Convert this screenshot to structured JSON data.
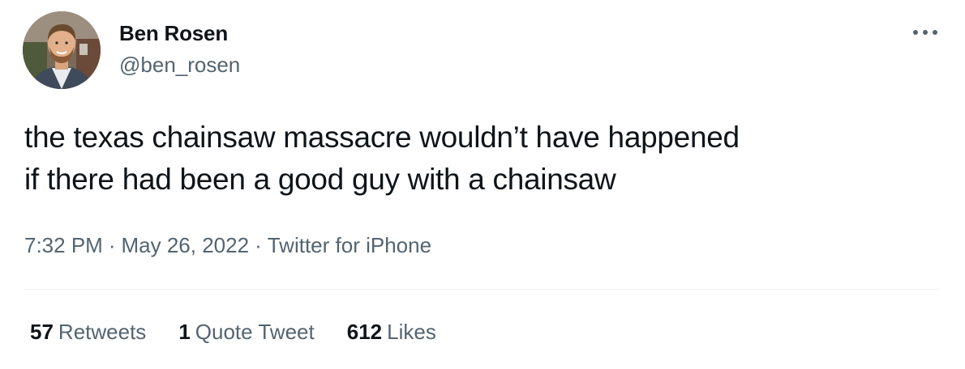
{
  "user": {
    "display_name": "Ben Rosen",
    "handle": "@ben_rosen"
  },
  "tweet": {
    "text_line_1": "the texas chainsaw massacre wouldn’t have happened",
    "text_line_2": "if there had been a good guy with a chainsaw",
    "time": "7:32 PM",
    "date": "May 26, 2022",
    "source": "Twitter for iPhone",
    "separator": "·"
  },
  "stats": {
    "retweets_count": "57",
    "retweets_label": "Retweets",
    "quotes_count": "1",
    "quotes_label": "Quote Tweet",
    "likes_count": "612",
    "likes_label": "Likes"
  },
  "icons": {
    "more": "more-horizontal-icon",
    "avatar": "user-avatar-photo"
  },
  "colors": {
    "text_primary": "#0f1419",
    "text_secondary": "#536471",
    "divider": "#eff3f4"
  }
}
